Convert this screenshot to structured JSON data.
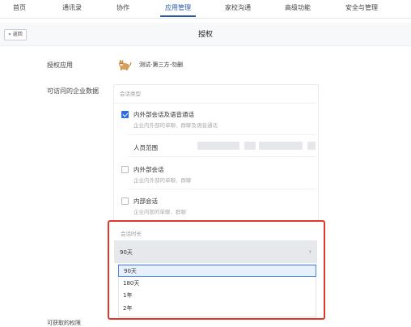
{
  "nav": {
    "items": [
      "首页",
      "通讯录",
      "协作",
      "应用管理",
      "家校沟通",
      "高级功能",
      "安全与管理"
    ],
    "active_index": 3
  },
  "header": {
    "back_label": "« 返回",
    "title": "授权"
  },
  "form": {
    "auth_app_label": "授权应用",
    "app_name": "测试-第三方-勿删",
    "accessible_data_label": "可访问的企业数据",
    "next_label": "可获取的权限"
  },
  "session_panel": {
    "title": "会话类型",
    "options": [
      {
        "title": "内外部会话及语音通话",
        "desc": "企业内外部的单聊、群聊及语音通话",
        "checked": true
      },
      {
        "title": "内外部会话",
        "desc": "企业内外部的单聊、群聊",
        "checked": false
      },
      {
        "title": "内部会话",
        "desc": "企业内部的单聊、群聊",
        "checked": false
      }
    ],
    "member_scope_label": "人员范围"
  },
  "duration": {
    "title": "会话时长",
    "selected_value": "90天",
    "chevron": "›",
    "options": [
      "90天",
      "180天",
      "1年",
      "2年"
    ],
    "selected_index": 0
  },
  "colors": {
    "accent": "#2a5aa8",
    "checkbox": "#2b6fe0",
    "highlight_border": "#e0382f"
  }
}
